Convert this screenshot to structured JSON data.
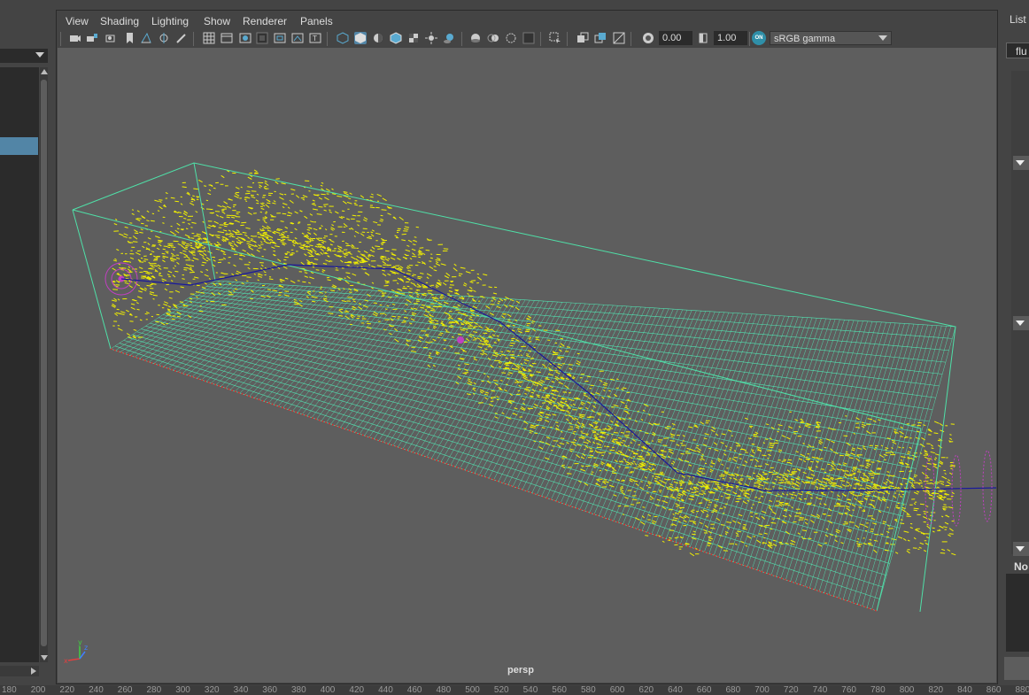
{
  "menus": [
    "View",
    "Shading",
    "Lighting",
    "Show",
    "Renderer",
    "Panels"
  ],
  "toolbar": {
    "exposure_value": "0.00",
    "gamma_value": "1.00",
    "color_space": "sRGB gamma",
    "colormgmt_label": "ON"
  },
  "viewport": {
    "camera": "persp",
    "axis_x": "x",
    "axis_y": "y",
    "axis_z": "z"
  },
  "right_panel": {
    "tab_label": "List",
    "node_field": "flu",
    "notes_label": "No"
  },
  "timeline_ruler": [
    "180",
    "200",
    "220",
    "240",
    "260",
    "280",
    "300",
    "320",
    "340",
    "360",
    "380",
    "400",
    "420",
    "440",
    "460",
    "480",
    "500",
    "520",
    "540",
    "560",
    "580",
    "600",
    "620",
    "640",
    "660",
    "680",
    "700",
    "720",
    "740",
    "760",
    "780",
    "800",
    "820",
    "840",
    "860",
    "880"
  ]
}
